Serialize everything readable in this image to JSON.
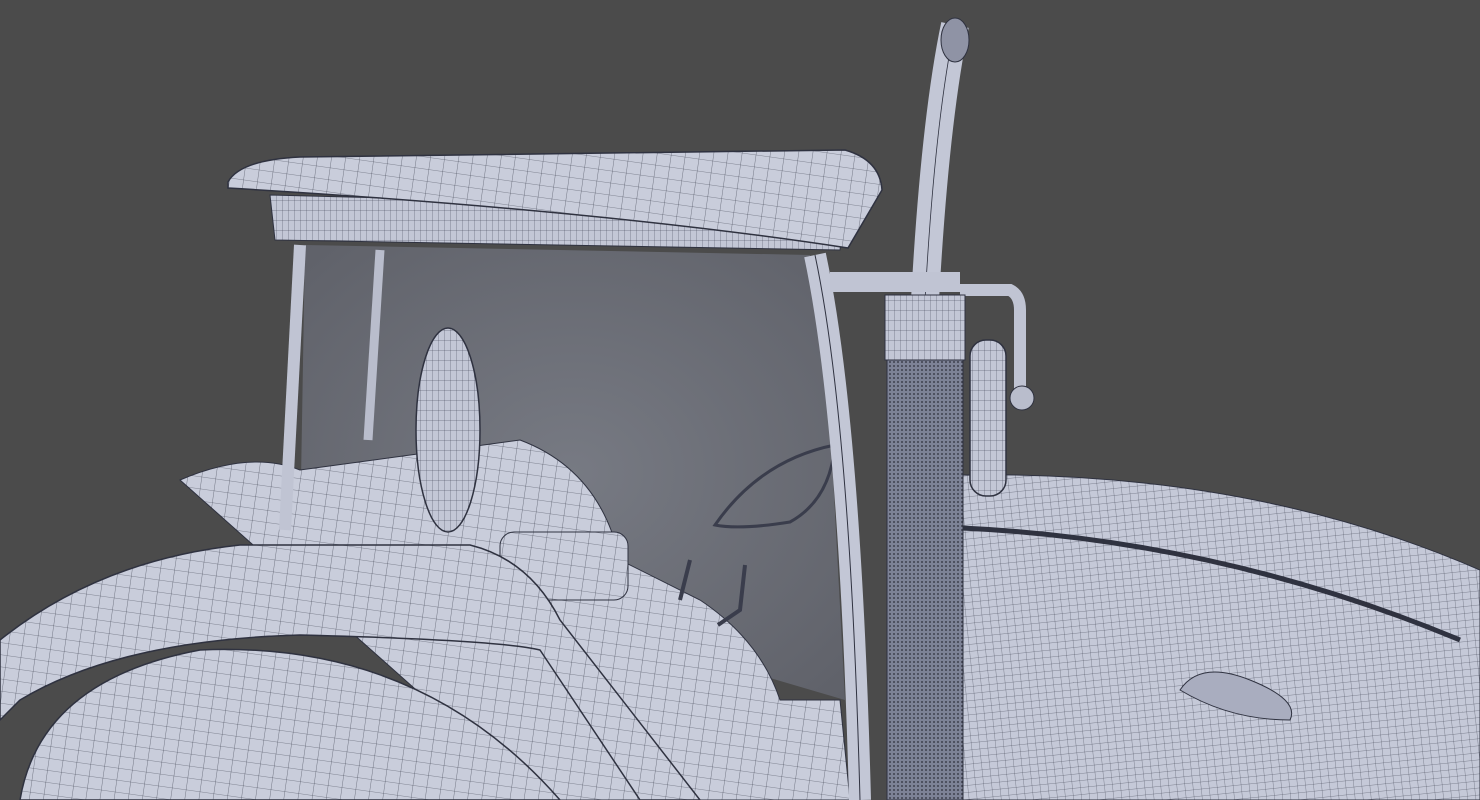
{
  "scene": {
    "subject": "tractor-wireframe-render",
    "colors": {
      "background": "#4b4b4b",
      "surface": "#c9cddb",
      "surface_shadow": "#9a9fb2",
      "wire": "#2f3240",
      "glass": "#6c6e76"
    }
  }
}
